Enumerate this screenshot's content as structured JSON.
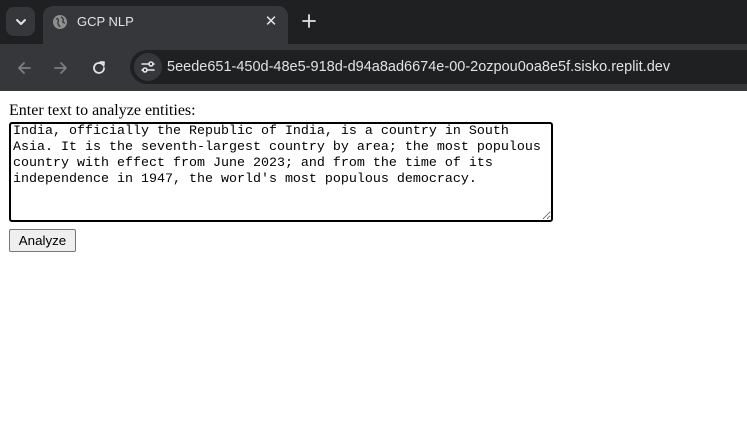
{
  "browser": {
    "tab": {
      "title": "GCP NLP"
    },
    "address_bar": {
      "url": "5eede651-450d-48e5-918d-d94a8ad6674e-00-2ozpou0oa8e5f.sisko.replit.dev"
    },
    "icons": {
      "tab_search": "chevron-down-icon",
      "favicon": "globe-icon",
      "close": "close-icon",
      "new_tab": "plus-icon",
      "back": "arrow-left-icon",
      "forward": "arrow-right-icon",
      "reload": "reload-icon",
      "site_info": "tune-icon"
    },
    "close_glyph": "✕"
  },
  "page": {
    "prompt_label": "Enter text to analyze entities:",
    "text_input_value": "India, officially the Republic of India, is a country in South Asia. It is the seventh-largest country by area; the most populous country with effect from June 2023; and from the time of its independence in 1947, the world's most populous democracy.",
    "analyze_button_label": "Analyze"
  },
  "colors": {
    "tabstrip_bg": "#1f2022",
    "toolbar_bg": "#36373a",
    "chrome_text": "#e3e3e3",
    "page_bg": "#ffffff"
  }
}
